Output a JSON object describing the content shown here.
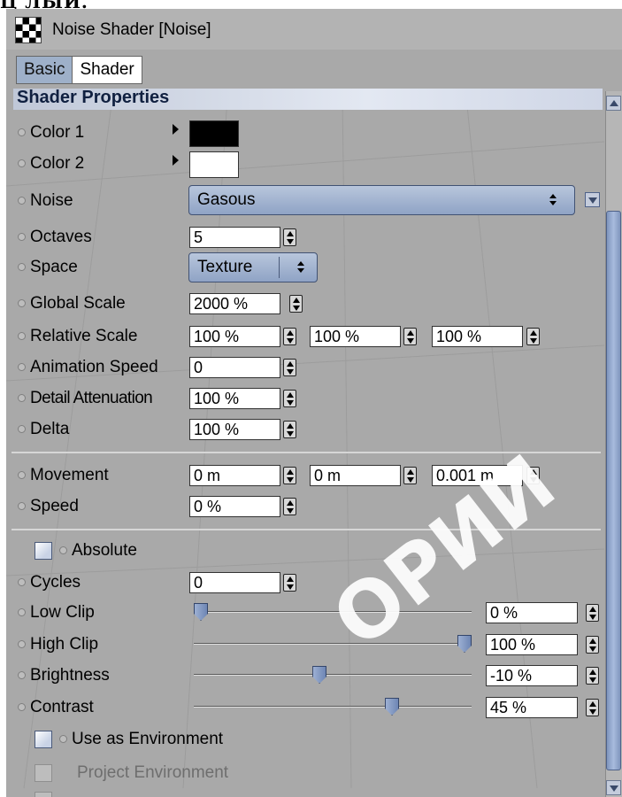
{
  "top_text": "Ц ЛЫЙ.",
  "window": {
    "title": "Noise Shader [Noise]"
  },
  "tabs": [
    {
      "label": "Basic"
    },
    {
      "label": "Shader"
    }
  ],
  "section_title": "Shader Properties",
  "properties": {
    "color1": {
      "label": "Color 1",
      "value_color": "#000000"
    },
    "color2": {
      "label": "Color 2",
      "value_color": "#ffffff"
    },
    "noise": {
      "label": "Noise",
      "value": "Gasous"
    },
    "octaves": {
      "label": "Octaves",
      "value": "5"
    },
    "space": {
      "label": "Space",
      "value": "Texture"
    },
    "global_scale": {
      "label": "Global Scale",
      "value": "2000 %"
    },
    "relative_scale": {
      "label": "Relative Scale",
      "values": [
        "100 %",
        "100 %",
        "100 %"
      ]
    },
    "animation_speed": {
      "label": "Animation Speed",
      "value": "0"
    },
    "detail_attenuation": {
      "label": "Detail Attenuation",
      "value": "100 %"
    },
    "delta": {
      "label": "Delta",
      "value": "100 %"
    },
    "movement": {
      "label": "Movement",
      "values": [
        "0 m",
        "0 m",
        "0.001 m"
      ]
    },
    "speed": {
      "label": "Speed",
      "value": "0 %"
    },
    "absolute": {
      "label": "Absolute",
      "checked": false
    },
    "cycles": {
      "label": "Cycles",
      "value": "0"
    },
    "low_clip": {
      "label": "Low Clip",
      "value": "0 %",
      "slider": 0.0
    },
    "high_clip": {
      "label": "High Clip",
      "value": "100 %",
      "slider": 1.0
    },
    "brightness": {
      "label": "Brightness",
      "value": "-10 %",
      "slider": 0.45
    },
    "contrast": {
      "label": "Contrast",
      "value": "45 %",
      "slider": 0.725
    },
    "use_as_environment": {
      "label": "Use as Environment",
      "checked": false
    },
    "project_environment": {
      "label": "Project Environment",
      "checked": false,
      "disabled": true
    }
  },
  "watermark": "ОРИИ",
  "colors": {
    "panel_bg": "#a9a9a9",
    "accent_blue": "#8fa3c5",
    "scroll_thumb": "#8fa3c5"
  }
}
